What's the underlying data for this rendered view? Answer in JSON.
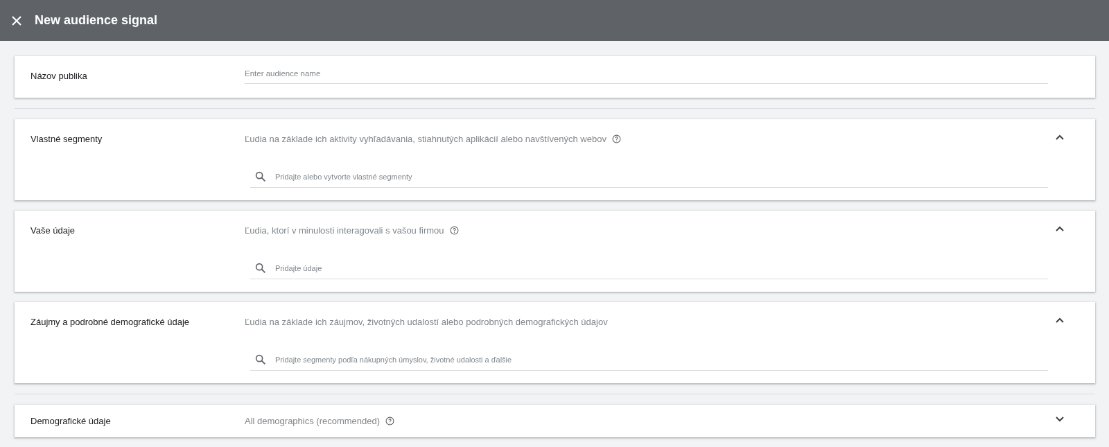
{
  "header": {
    "title": "New audience signal"
  },
  "groups": [
    {
      "sections": [
        {
          "kind": "name",
          "label": "Názov publika",
          "placeholder": "Enter audience name"
        }
      ]
    },
    {
      "sections": [
        {
          "kind": "search",
          "label": "Vlastné segmenty",
          "description": "Ľudia na základe ich aktivity vyhľadávania, stiahnutých aplikácií alebo navštívených webov",
          "help": true,
          "expanded": true,
          "placeholder": "Pridajte alebo vytvorte vlastné segmenty"
        },
        {
          "kind": "search",
          "label": "Vaše údaje",
          "description": "Ľudia, ktorí v minulosti interagovali s vašou firmou",
          "help": true,
          "expanded": true,
          "placeholder": "Pridajte údaje"
        },
        {
          "kind": "search",
          "label": "Záujmy a podrobné demografické údaje",
          "description": "Ľudia na základe ich záujmov, životných udalostí alebo podrobných demografických údajov",
          "help": false,
          "expanded": true,
          "placeholder": "Pridajte segmenty podľa nákupných úmyslov, životné udalosti a ďalšie"
        }
      ]
    },
    {
      "sections": [
        {
          "kind": "search",
          "label": "Demografické údaje",
          "description": "All demographics (recommended)",
          "help": true,
          "expanded": false
        }
      ]
    }
  ]
}
